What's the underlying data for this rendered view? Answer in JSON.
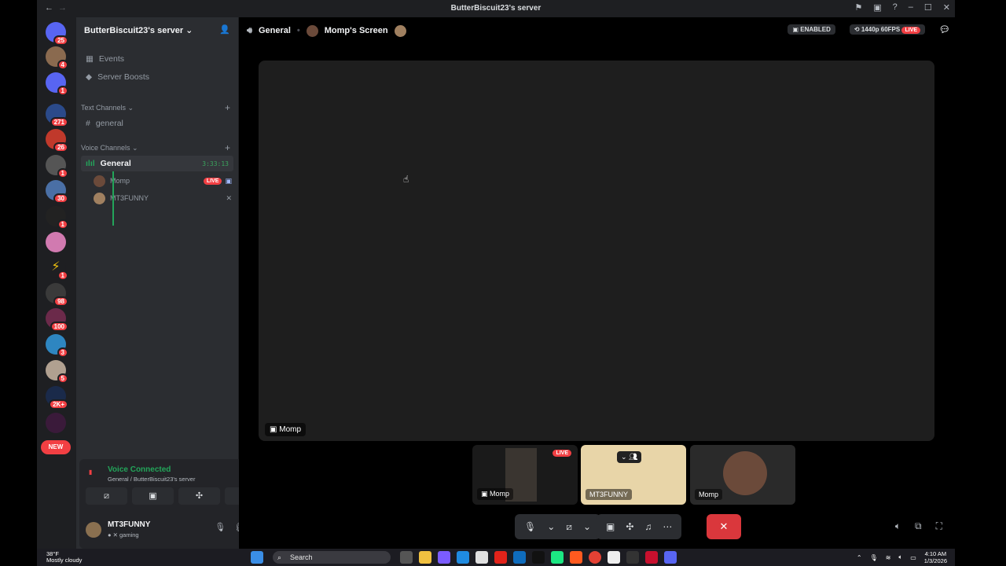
{
  "window": {
    "title": "ButterBiscuit23's server",
    "nav_back": "←",
    "nav_forward": "→"
  },
  "guild_badges": [
    "25",
    "4",
    "1",
    "271",
    "26",
    "1",
    "30",
    "1",
    "1",
    "98",
    "100",
    "3",
    "5",
    "2K+"
  ],
  "new_label": "NEW",
  "server": {
    "name": "ButterBiscuit23's server ⌄",
    "items": [
      "Events",
      "Server Boosts"
    ],
    "text_category": "Text Channels ⌄",
    "text_channel": "general",
    "voice_category": "Voice Channels ⌄",
    "voice_channel": "General",
    "voice_timer": "3:33:13",
    "voice_users": [
      {
        "name": "Momp",
        "live": "LIVE"
      },
      {
        "name": "MT3FUNNY"
      }
    ]
  },
  "voice_panel": {
    "status": "Voice Connected",
    "location": "General / ButterBiscuit23's server",
    "user_name": "MT3FUNNY",
    "activity": "gaming"
  },
  "stage": {
    "channel": "General",
    "screen_title": "Momp's Screen",
    "enabled_badge": "ENABLED",
    "quality_badge": "1440p 60FPS",
    "live_badge": "LIVE",
    "screen_label": "Momp",
    "tiles": [
      {
        "label": "Momp",
        "live": "LIVE"
      },
      {
        "label": "MT3FUNNY"
      },
      {
        "label": "Momp"
      }
    ]
  },
  "taskbar": {
    "temperature": "38°F",
    "weather": "Mostly cloudy",
    "search": "Search",
    "time": "4:10 AM",
    "date": "1/3/2026"
  }
}
